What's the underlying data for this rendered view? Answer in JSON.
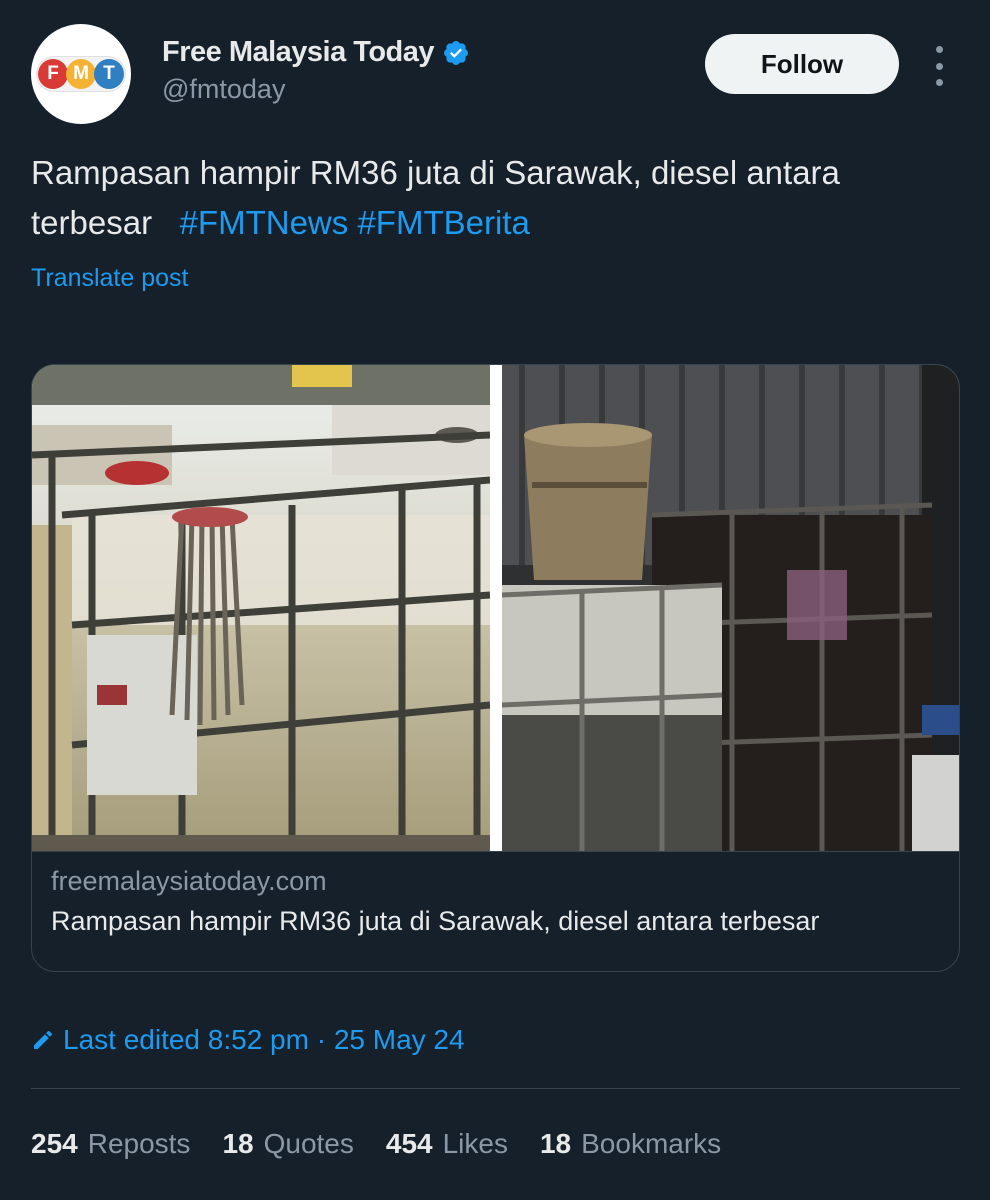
{
  "author": {
    "avatar_logo_text": [
      "F",
      "M",
      "T"
    ],
    "display_name": "Free Malaysia Today",
    "handle": "@fmtoday",
    "verified_icon": "verified-badge-icon"
  },
  "actions": {
    "follow_label": "Follow",
    "more_icon": "more-vertical-icon"
  },
  "post": {
    "text": "Rampasan hampir RM36 juta di Sarawak, diesel antara terbesar",
    "hashtags": [
      "#FMTNews",
      "#FMTBerita"
    ],
    "translate_label": "Translate post"
  },
  "link_card": {
    "domain": "freemalaysiatoday.com",
    "title": "Rampasan hampir RM36 juta di Sarawak, diesel antara terbesar"
  },
  "edited": {
    "icon": "pencil-icon",
    "text": "Last edited 8:52 pm · 25 May 24"
  },
  "stats": [
    {
      "count": "254",
      "label": "Reposts"
    },
    {
      "count": "18",
      "label": "Quotes"
    },
    {
      "count": "454",
      "label": "Likes"
    },
    {
      "count": "18",
      "label": "Bookmarks"
    }
  ],
  "colors": {
    "background": "#15202b",
    "text_primary": "#e7e9ea",
    "text_secondary": "#8b98a5",
    "accent": "#1d9bf0",
    "border": "#38444d",
    "fmt_red": "#d93a35",
    "fmt_yellow": "#f5b335",
    "fmt_blue": "#2f7fc2"
  }
}
